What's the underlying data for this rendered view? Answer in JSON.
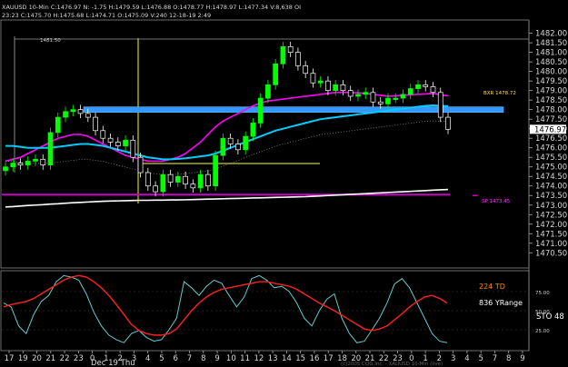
{
  "header": {
    "line1": "XAUUSD 10-Min  C:1476.97  N: -1.75  H:1479.59  L:1476.88  O:1478.77  H:1478.97  L:1477.34  V:8,638  OI",
    "line2": "23:23  C:1475.70  H:1475.68  L:1474.71  O:1475.09  V:240  12-18-19  2:49"
  },
  "colors": {
    "up": "#00ff00",
    "down": "#ffffff",
    "cyan_ma": "#00ccff",
    "magenta_ma": "#ff00ff",
    "white_ma": "#ffffff",
    "resistance_band": "#3399ff",
    "support_line": "#cc00cc",
    "stoch_k": "#66cccc",
    "stoch_d": "#ff2020",
    "price_last_bg": "#ffffff"
  },
  "chart_data": [
    {
      "type": "line",
      "title": "XAUUSD 10-Min",
      "ylim": [
        1469.8,
        1482.6
      ],
      "y_ticks": [
        "1482.00",
        "1481.50",
        "1481.00",
        "1480.50",
        "1480.00",
        "1479.50",
        "1479.00",
        "1478.50",
        "1478.00",
        "1477.50",
        "1477.00",
        "1476.50",
        "1476.00",
        "1475.50",
        "1475.00",
        "1474.50",
        "1474.00",
        "1473.50",
        "1473.00",
        "1472.50",
        "1472.00",
        "1471.50",
        "1471.00",
        "1470.50"
      ],
      "last_price": "1476.97",
      "x_ticks": [
        "17",
        "19",
        "20",
        "21",
        "22",
        "23",
        "0",
        "1",
        "2",
        "3",
        "4",
        "5",
        "6",
        "7",
        "8",
        "9",
        "10",
        "11",
        "12",
        "13",
        "14",
        "15",
        "16",
        "17",
        "18",
        "20",
        "21",
        "22",
        "23",
        "0",
        "1",
        "2",
        "3",
        "4",
        "5",
        "7",
        "8",
        "9"
      ],
      "x_date_label": "Dec 19 Thu",
      "levels": {
        "resistance": 1478.0,
        "support": 1473.55,
        "left_label": "1481.50"
      },
      "annotations": [
        {
          "text": "BXR 1478.72",
          "y": 1478.72
        },
        {
          "text": "SP 1473.45",
          "y": 1473.45
        }
      ],
      "series": [
        {
          "role": "price",
          "values": [
            1475.0,
            1475.2,
            1475.1,
            1475.3,
            1475.4,
            1475.1,
            1476.8,
            1477.6,
            1477.9,
            1478.0,
            1477.8,
            1477.6,
            1476.9,
            1476.5,
            1476.3,
            1476.1,
            1476.4,
            1475.5,
            1474.7,
            1474.0,
            1473.7,
            1474.6,
            1474.2,
            1474.5,
            1474.1,
            1473.9,
            1474.6,
            1474.0,
            1475.6,
            1476.5,
            1476.2,
            1475.9,
            1476.6,
            1477.3,
            1478.6,
            1479.3,
            1480.4,
            1481.3,
            1481.0,
            1480.3,
            1479.9,
            1479.4,
            1479.5,
            1479.0,
            1479.3,
            1479.0,
            1478.7,
            1478.8,
            1478.9,
            1478.4,
            1478.3,
            1478.6,
            1478.6,
            1478.8,
            1479.1,
            1479.3,
            1479.2,
            1478.9,
            1477.6,
            1476.97
          ]
        },
        {
          "role": "ma",
          "values": [
            1475.3,
            1475.4,
            1475.5,
            1475.7,
            1475.9,
            1476.1,
            1476.3,
            1476.5,
            1476.6,
            1476.7,
            1476.7,
            1476.6,
            1476.4,
            1476.2,
            1476.0,
            1475.8,
            1475.6,
            1475.5,
            1475.4,
            1475.3,
            1475.3,
            1475.3,
            1475.4,
            1475.5,
            1475.7,
            1476.0,
            1476.3,
            1476.7,
            1477.1,
            1477.4,
            1477.6,
            1477.8,
            1478.0,
            1478.2,
            1478.35,
            1478.45,
            1478.5,
            1478.55,
            1478.6,
            1478.65,
            1478.7,
            1478.75,
            1478.8,
            1478.85,
            1478.9,
            1478.9,
            1478.9,
            1478.88,
            1478.85,
            1478.8,
            1478.75,
            1478.7,
            1478.72,
            1478.75,
            1478.78,
            1478.8,
            1478.82,
            1478.85,
            1478.78,
            1478.72
          ]
        },
        {
          "role": "ma",
          "values": [
            1476.1,
            1476.1,
            1476.05,
            1476.0,
            1476.0,
            1476.0,
            1476.0,
            1476.05,
            1476.1,
            1476.15,
            1476.2,
            1476.2,
            1476.15,
            1476.1,
            1476.0,
            1475.9,
            1475.8,
            1475.7,
            1475.6,
            1475.5,
            1475.45,
            1475.4,
            1475.4,
            1475.42,
            1475.45,
            1475.5,
            1475.55,
            1475.6,
            1475.7,
            1475.85,
            1476.0,
            1476.15,
            1476.3,
            1476.45,
            1476.6,
            1476.75,
            1476.9,
            1477.0,
            1477.1,
            1477.2,
            1477.3,
            1477.4,
            1477.5,
            1477.55,
            1477.6,
            1477.65,
            1477.7,
            1477.75,
            1477.8,
            1477.85,
            1477.9,
            1477.95,
            1478.0,
            1478.05,
            1478.1,
            1478.15,
            1478.2,
            1478.22,
            1478.2,
            1478.18
          ]
        },
        {
          "role": "ma",
          "values": [
            1472.9,
            1472.92,
            1472.95,
            1472.98,
            1473.0,
            1473.02,
            1473.05,
            1473.07,
            1473.1,
            1473.12,
            1473.14,
            1473.16,
            1473.18,
            1473.2,
            1473.21,
            1473.22,
            1473.23,
            1473.24,
            1473.25,
            1473.25,
            1473.26,
            1473.26,
            1473.27,
            1473.27,
            1473.28,
            1473.29,
            1473.3,
            1473.31,
            1473.32,
            1473.33,
            1473.34,
            1473.35,
            1473.36,
            1473.37,
            1473.38,
            1473.39,
            1473.4,
            1473.41,
            1473.42,
            1473.43,
            1473.44,
            1473.46,
            1473.48,
            1473.5,
            1473.52,
            1473.54,
            1473.56,
            1473.58,
            1473.6,
            1473.62,
            1473.64,
            1473.66,
            1473.68,
            1473.7,
            1473.72,
            1473.74,
            1473.76,
            1473.78,
            1473.8,
            1473.82
          ]
        }
      ]
    },
    {
      "type": "line",
      "ylim": [
        0,
        100
      ],
      "y_ticks": [
        "75.00",
        "50.00",
        "25.00"
      ],
      "labels": {
        "td": "224 TD",
        "yrange": "836 YRange",
        "sto": "STO  48"
      },
      "series": [
        {
          "role": "stoch_k",
          "values": [
            60,
            55,
            30,
            20,
            45,
            62,
            70,
            88,
            96,
            94,
            90,
            72,
            48,
            30,
            18,
            12,
            8,
            20,
            24,
            15,
            10,
            12,
            25,
            40,
            88,
            80,
            70,
            82,
            90,
            86,
            70,
            55,
            68,
            92,
            96,
            90,
            80,
            82,
            75,
            60,
            40,
            30,
            50,
            65,
            72,
            40,
            20,
            8,
            10,
            25,
            40,
            60,
            85,
            92,
            80,
            60,
            40,
            20,
            10,
            8
          ]
        },
        {
          "role": "stoch_d",
          "values": [
            55,
            58,
            60,
            62,
            66,
            72,
            78,
            84,
            90,
            94,
            96,
            94,
            88,
            80,
            70,
            58,
            45,
            32,
            24,
            20,
            18,
            18,
            20,
            26,
            38,
            50,
            60,
            68,
            74,
            78,
            80,
            82,
            84,
            86,
            88,
            88,
            86,
            84,
            82,
            78,
            72,
            66,
            60,
            55,
            50,
            44,
            38,
            32,
            26,
            24,
            26,
            30,
            38,
            46,
            55,
            62,
            68,
            70,
            66,
            60
          ]
        }
      ]
    }
  ],
  "watermark": "(c)2005 CQG,Inc. - XAUUSD 10-Min (live)"
}
